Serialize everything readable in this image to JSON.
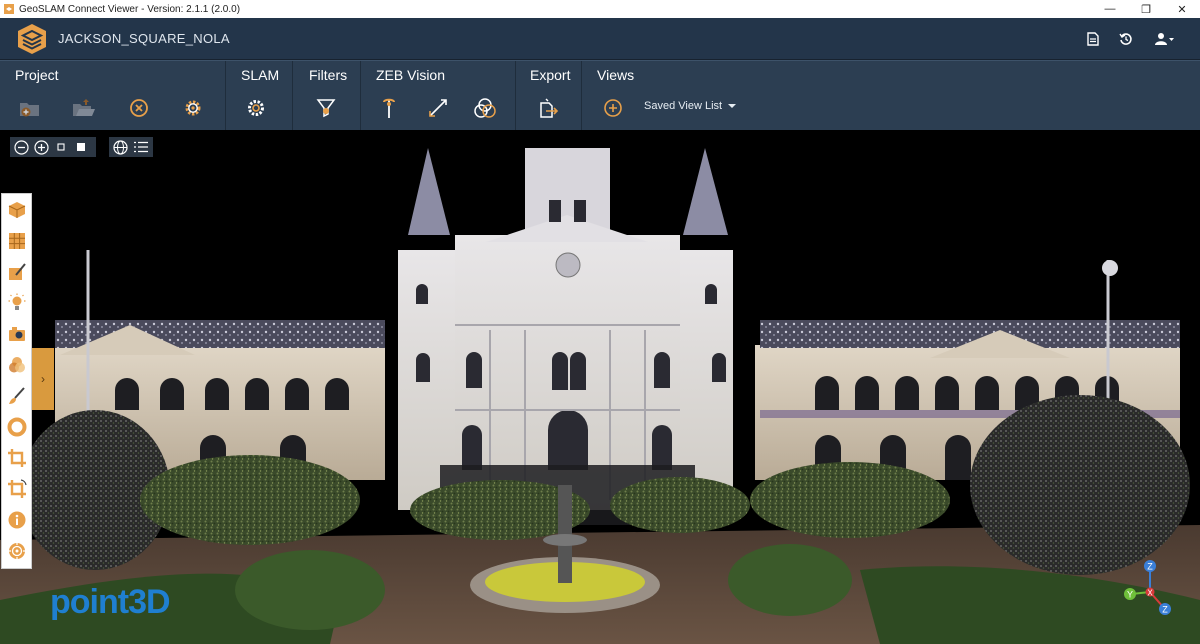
{
  "window": {
    "title": "GeoSLAM Connect Viewer - Version: 2.1.1 (2.0.0)",
    "controls": {
      "minimize": "—",
      "restore": "❐",
      "close": "✕"
    }
  },
  "header": {
    "project_name": "JACKSON_SQUARE_NOLA",
    "icons": [
      "report-icon",
      "history-icon",
      "user-icon"
    ]
  },
  "ribbon": {
    "groups": [
      {
        "title": "Project",
        "icons": [
          "add-scan-icon",
          "open-folder-icon",
          "close-project-icon",
          "settings-icon"
        ]
      },
      {
        "title": "SLAM",
        "icons": [
          "slam-process-icon"
        ]
      },
      {
        "title": "Filters",
        "icons": [
          "filter-icon"
        ]
      },
      {
        "title": "ZEB Vision",
        "icons": [
          "pin-icon",
          "measure-icon",
          "overlap-icon"
        ]
      },
      {
        "title": "Export",
        "icons": [
          "export-icon"
        ]
      },
      {
        "title": "Views",
        "icons": [
          "add-view-icon"
        ]
      }
    ],
    "saved_view_list": "Saved View List"
  },
  "viewport": {
    "zoom_controls": [
      "zoom-out-icon",
      "zoom-in-icon",
      "point-size-small-icon",
      "point-size-large-icon"
    ],
    "view_controls": [
      "globe-icon",
      "layer-list-icon"
    ],
    "side_tools": [
      "cube-icon",
      "grid-icon",
      "paint-icon",
      "light-icon",
      "camera-icon",
      "color-blend-icon",
      "brush-icon",
      "donut-icon",
      "crop-icon",
      "crop-rotate-icon",
      "info-icon",
      "target-icon"
    ],
    "watermark": "point3D",
    "axis_labels": {
      "z": "Z",
      "y": "Y",
      "x": "X"
    }
  },
  "colors": {
    "accent": "#e8a04a",
    "header_bg": "#23354a",
    "ribbon_bg": "#2c3e52"
  }
}
